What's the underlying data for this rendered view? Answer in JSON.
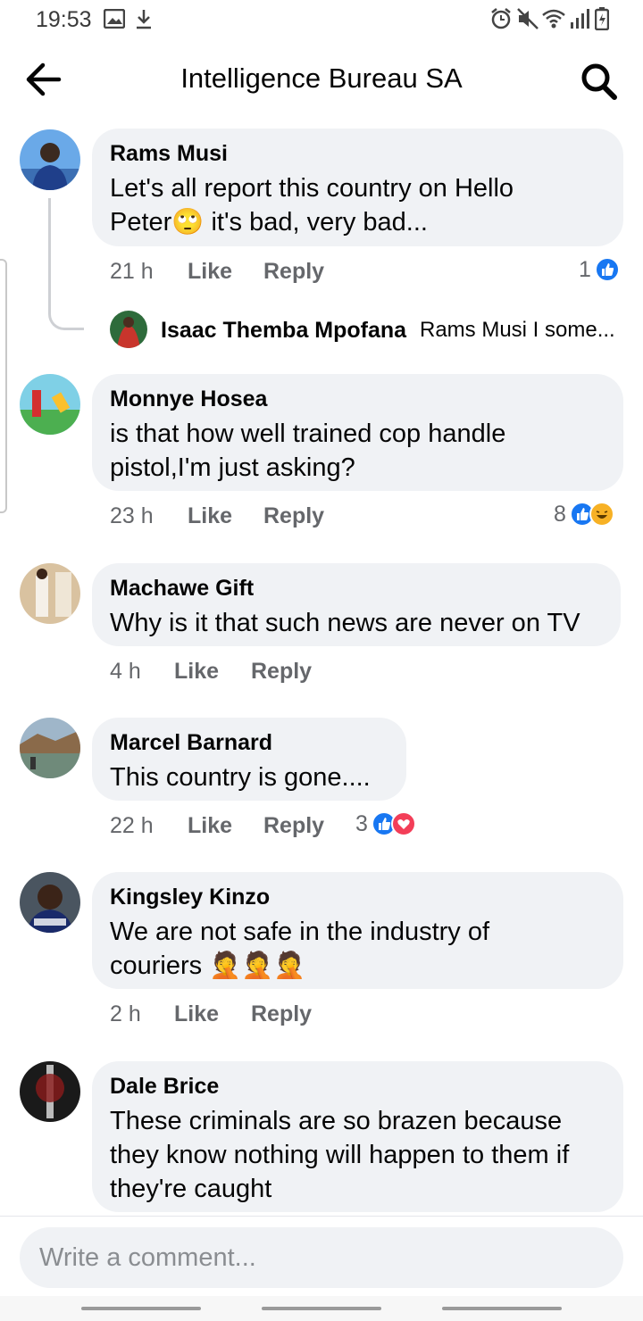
{
  "status_bar": {
    "time": "19:53",
    "left_icons": [
      "image-icon",
      "download-icon"
    ],
    "right_icons": [
      "alarm-icon",
      "mute-icon",
      "wifi-icon",
      "signal-icon",
      "battery-icon"
    ]
  },
  "header": {
    "title": "Intelligence Bureau SA",
    "back_icon": "arrow-left-icon",
    "search_icon": "search-icon"
  },
  "comments": [
    {
      "author": "Rams Musi",
      "text_lines": [
        "Let's all report this country on Hello",
        "Peter🙄 it's bad, very bad..."
      ],
      "time": "21 h",
      "like_label": "Like",
      "reply_label": "Reply",
      "reaction_count": "1",
      "reactions": [
        "like"
      ],
      "reply_preview": {
        "author": "Isaac Themba Mpofana",
        "snippet": "Rams Musi I some..."
      }
    },
    {
      "author": "Monnye Hosea",
      "text_lines": [
        "is that how well trained cop handle",
        "pistol,I'm just asking?"
      ],
      "time": "23 h",
      "like_label": "Like",
      "reply_label": "Reply",
      "reaction_count": "8",
      "reactions": [
        "like",
        "haha"
      ]
    },
    {
      "author": "Machawe Gift",
      "text_lines": [
        "Why is it that such news are never on TV"
      ],
      "time": "4 h",
      "like_label": "Like",
      "reply_label": "Reply"
    },
    {
      "author": "Marcel Barnard",
      "text_lines": [
        "This country is gone...."
      ],
      "time": "22 h",
      "like_label": "Like",
      "reply_label": "Reply",
      "reaction_count": "3",
      "reactions": [
        "like",
        "love"
      ]
    },
    {
      "author": "Kingsley Kinzo",
      "text_lines": [
        "We are not safe in the industry of",
        "couriers 🤦🤦🤦"
      ],
      "time": "2 h",
      "like_label": "Like",
      "reply_label": "Reply"
    },
    {
      "author": "Dale Brice",
      "text_lines": [
        "These criminals are so brazen because",
        "they know nothing will happen to them if",
        "they're caught"
      ]
    }
  ],
  "composer": {
    "placeholder": "Write a comment..."
  },
  "colors": {
    "bubble": "#f0f2f5",
    "meta_text": "#65676b",
    "like_blue": "#1877f2",
    "love_red": "#f33e58",
    "haha_yellow": "#f7b125"
  }
}
